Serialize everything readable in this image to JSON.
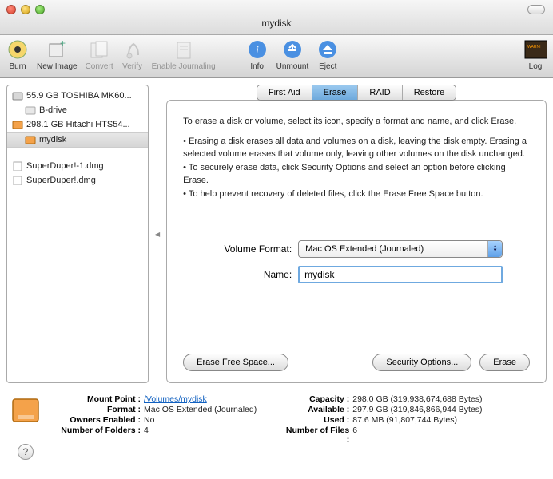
{
  "window": {
    "title": "mydisk"
  },
  "toolbar": {
    "burn": "Burn",
    "new_image": "New Image",
    "convert": "Convert",
    "verify": "Verify",
    "journal": "Enable Journaling",
    "info": "Info",
    "unmount": "Unmount",
    "eject": "Eject",
    "log": "Log"
  },
  "sidebar": {
    "items": [
      {
        "label": "55.9 GB TOSHIBA MK60...",
        "icon": "hdd"
      },
      {
        "label": "B-drive",
        "icon": "vol",
        "indent": 1
      },
      {
        "label": "298.1 GB Hitachi HTS54...",
        "icon": "ext"
      },
      {
        "label": "mydisk",
        "icon": "vol",
        "indent": 1,
        "selected": true
      },
      {
        "label": "SuperDuper!-1.dmg",
        "icon": "dmg"
      },
      {
        "label": "SuperDuper!.dmg",
        "icon": "dmg"
      }
    ]
  },
  "tabs": {
    "first_aid": "First Aid",
    "erase": "Erase",
    "raid": "RAID",
    "restore": "Restore"
  },
  "erase": {
    "intro": "To erase a disk or volume, select its icon, specify a format and name, and click Erase.",
    "b1": "• Erasing a disk erases all data and volumes on a disk, leaving the disk empty. Erasing a selected volume erases that volume only, leaving other volumes on the disk unchanged.",
    "b2": "• To securely erase data, click Security Options and select an option before clicking Erase.",
    "b3": "• To help prevent recovery of deleted files, click the Erase Free Space button.",
    "format_label": "Volume Format:",
    "format_value": "Mac OS Extended (Journaled)",
    "name_label": "Name:",
    "name_value": "mydisk",
    "btn_free": "Erase Free Space...",
    "btn_sec": "Security Options...",
    "btn_erase": "Erase"
  },
  "footer": {
    "mount_k": "Mount Point :",
    "mount_v": "/Volumes/mydisk",
    "format_k": "Format :",
    "format_v": "Mac OS Extended (Journaled)",
    "owners_k": "Owners Enabled :",
    "owners_v": "No",
    "folders_k": "Number of Folders :",
    "folders_v": "4",
    "cap_k": "Capacity :",
    "cap_v": "298.0 GB (319,938,674,688 Bytes)",
    "avail_k": "Available :",
    "avail_v": "297.9 GB (319,846,866,944 Bytes)",
    "used_k": "Used :",
    "used_v": "87.6 MB (91,807,744 Bytes)",
    "files_k": "Number of Files :",
    "files_v": "6"
  }
}
